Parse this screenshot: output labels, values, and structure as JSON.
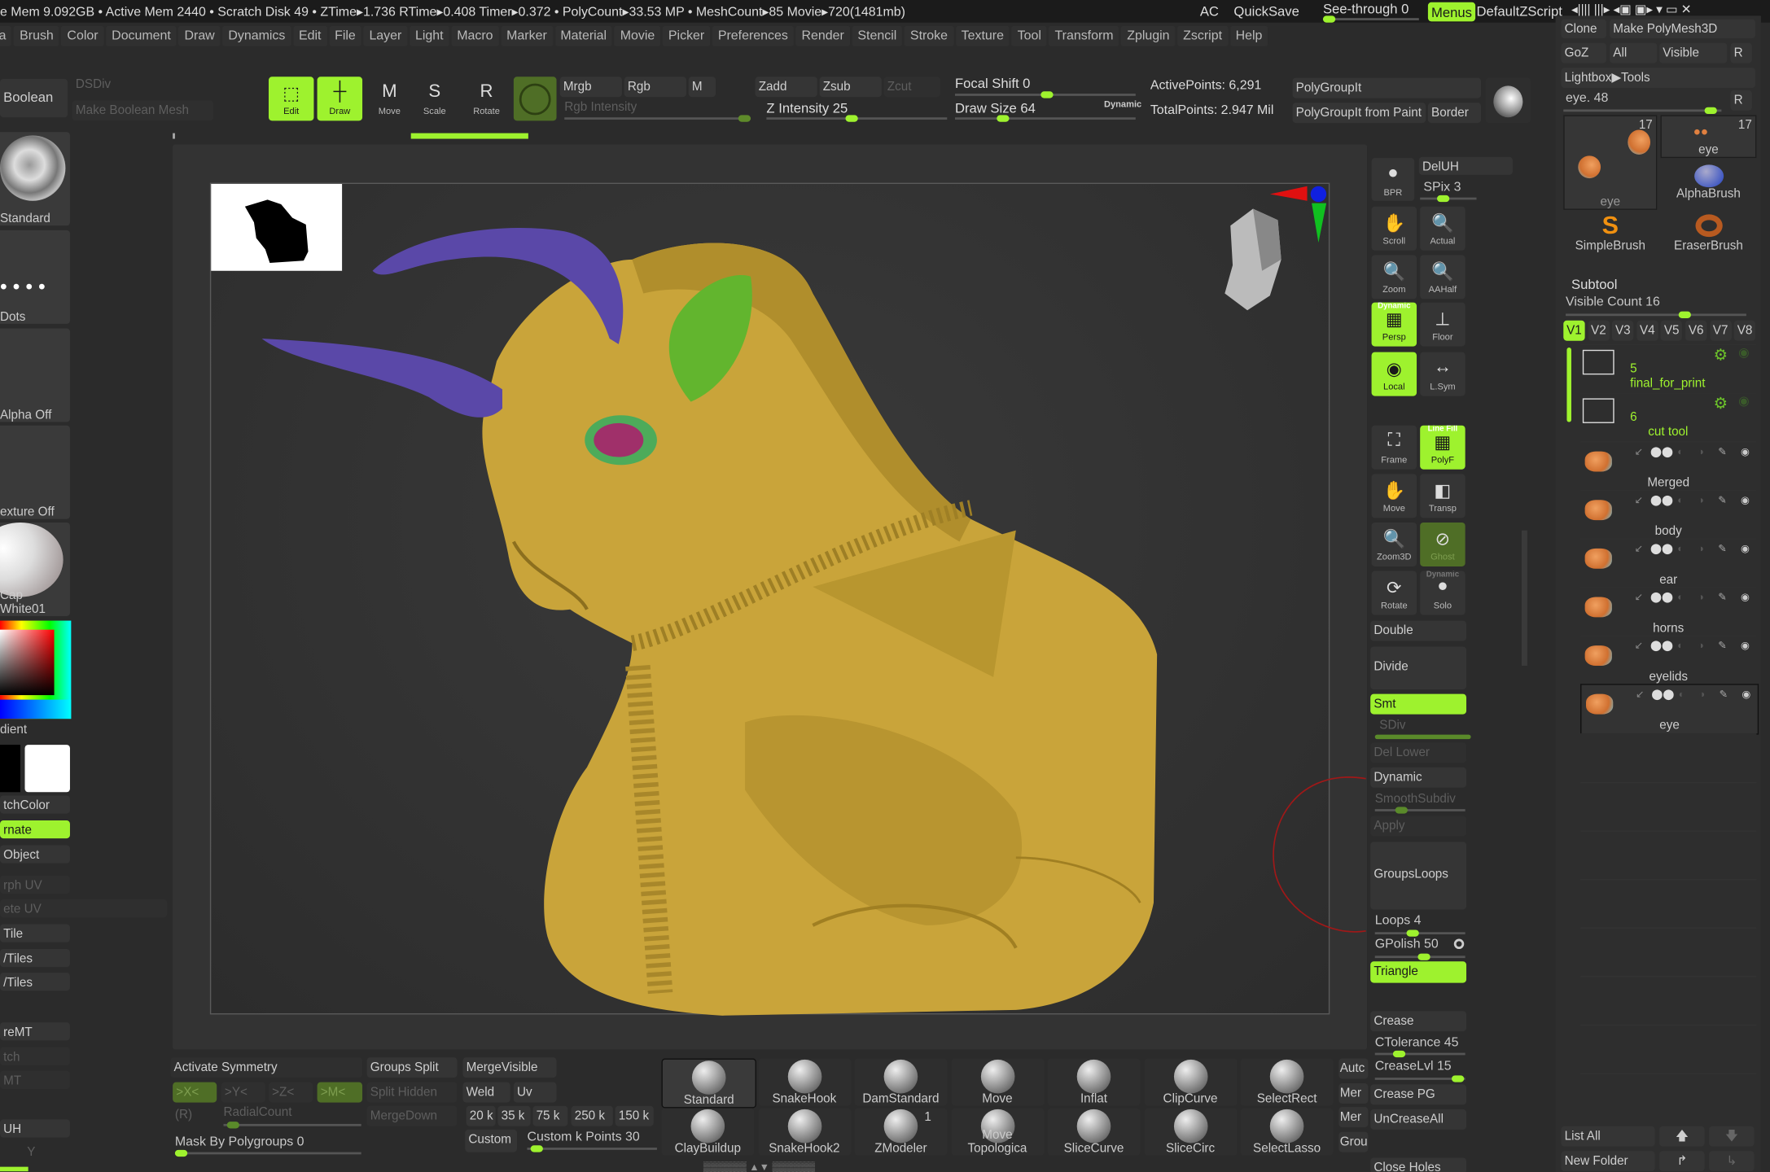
{
  "status_bar": {
    "text": "e Mem 9.092GB • Active Mem 2440 • Scratch Disk 49 •  ZTime▸1.736 RTime▸0.408 Timer▸0.372 • PolyCount▸33.53 MP  • MeshCount▸85  Movie▸720(1481mb)",
    "ac": "AC",
    "quicksave": "QuickSave",
    "see_through": "See-through  0",
    "see_through_value": 0,
    "menus": "Menus",
    "default_zscript": "DefaultZScript"
  },
  "menu": [
    "a",
    "Brush",
    "Color",
    "Document",
    "Draw",
    "Dynamics",
    "Edit",
    "File",
    "Layer",
    "Light",
    "Macro",
    "Marker",
    "Material",
    "Movie",
    "Picker",
    "Preferences",
    "Render",
    "Stencil",
    "Stroke",
    "Texture",
    "Tool",
    "Transform",
    "Zplugin",
    "Zscript",
    "Help"
  ],
  "toolbar": {
    "boolean": "Boolean",
    "dsdiv": "DSDiv",
    "make_boolean_mesh": "Make Boolean Mesh",
    "edit": "Edit",
    "draw": "Draw",
    "move": "Move",
    "scale": "Scale",
    "rotate": "Rotate",
    "mrgb": "Mrgb",
    "rgb": "Rgb",
    "m": "M",
    "rgb_intensity": "Rgb Intensity",
    "zadd": "Zadd",
    "zsub": "Zsub",
    "zcut": "Zcut",
    "z_intensity": "Z Intensity 25",
    "z_intensity_value": 25,
    "focal_shift": "Focal Shift 0",
    "focal_shift_value": 0,
    "draw_size": "Draw Size 64",
    "draw_size_value": 64,
    "dynamic": "Dynamic",
    "active_points": "ActivePoints: 6,291",
    "total_points": "TotalPoints: 2.947 Mil",
    "polygroupit": "PolyGroupIt",
    "polygroupit_from_paint": "PolyGroupIt from Paint",
    "border": "Border"
  },
  "left_shelf": {
    "brush": "Standard",
    "stroke": "Dots",
    "alpha": "Alpha Off",
    "texture": "exture Off",
    "material": "Cap White01",
    "gradient": "dient",
    "switch_color": "tchColor",
    "alternate": "rnate",
    "object": "Object",
    "morph_uv": "rph UV",
    "delete_uv": "ete UV",
    "tile": "Tile",
    "utiles": "/Tiles",
    "vtiles": "/Tiles",
    "remt": "reMT",
    "tch": "tch",
    "mt": "MT",
    "uh": "UH",
    "y": "Y"
  },
  "right_tools": {
    "bpr": "BPR",
    "deluh": "DelUH",
    "spix": "SPix 3",
    "scroll": "Scroll",
    "actual": "Actual",
    "zoom": "Zoom",
    "aahalf": "AAHalf",
    "persp": "Persp",
    "persp_tag": "Dynamic",
    "floor": "Floor",
    "local": "Local",
    "lsym": "L.Sym",
    "frame": "Frame",
    "polyf": "PolyF",
    "polyf_tag": "Line Fill",
    "move": "Move",
    "transp": "Transp",
    "zoom3d": "Zoom3D",
    "ghost": "Ghost",
    "rotate": "Rotate",
    "solo": "Solo",
    "solo_tag": "Dynamic",
    "double": "Double",
    "divide": "Divide",
    "smt": "Smt",
    "sdiv": "SDiv",
    "del_lower": "Del Lower",
    "dynamic": "Dynamic",
    "smooth_subdiv": "SmoothSubdiv",
    "apply": "Apply",
    "groups_loops": "GroupsLoops",
    "loops": "Loops 4",
    "gpolish": "GPolish 50",
    "triangle": "Triangle",
    "crease": "Crease",
    "ctolerance": "CTolerance 45",
    "creaselvl": "CreaseLvl 15",
    "crease_pg": "Crease PG",
    "uncrease_all": "UnCreaseAll",
    "close_holes": "Close Holes"
  },
  "tool_panel": {
    "clone": "Clone",
    "make_polymesh": "Make PolyMesh3D",
    "goz": "GoZ",
    "all": "All",
    "visible": "Visible",
    "r": "R",
    "lightbox_tools": "Lightbox▶Tools",
    "current_tool": "eye. 48",
    "thumbs": [
      {
        "label": "eye",
        "count": "17"
      },
      {
        "label": "eye",
        "count": "17"
      },
      {
        "label": "AlphaBrush"
      },
      {
        "label": "SimpleBrush"
      },
      {
        "label": "EraserBrush"
      }
    ]
  },
  "subtool": {
    "title": "Subtool",
    "visible_count": "Visible Count 16",
    "versions": [
      "V1",
      "V2",
      "V3",
      "V4",
      "V5",
      "V6",
      "V7",
      "V8"
    ],
    "active_version": "V1",
    "items": [
      {
        "number": "5",
        "name": "final_for_print",
        "type": "folder"
      },
      {
        "number": "6",
        "name": "cut tool",
        "type": "folder"
      },
      {
        "name": "Merged"
      },
      {
        "name": "body"
      },
      {
        "name": "ear"
      },
      {
        "name": "horns"
      },
      {
        "name": "eyelids"
      },
      {
        "name": "eye",
        "selected": true
      }
    ],
    "list_all": "List All",
    "new_folder": "New Folder"
  },
  "bottom": {
    "activate_symmetry": "Activate Symmetry",
    "x": ">X<",
    "y": ">Y<",
    "z": ">Z<",
    "m": ">M<",
    "r": "(R)",
    "radial_count": "RadialCount",
    "mask_by_polygroups": "Mask By Polygroups 0",
    "groups_split": "Groups Split",
    "split_hidden": "Split Hidden",
    "merge_down": "MergeDown",
    "merge_visible": "MergeVisible",
    "weld": "Weld",
    "uv": "Uv",
    "presets": [
      "20 k",
      "35 k",
      "75 k",
      "250 k",
      "150 k"
    ],
    "custom": "Custom",
    "custom_k_points": "Custom k Points 30",
    "brushes": [
      "Standard",
      "SnakeHook",
      "DamStandard",
      "Move",
      "Inflat",
      "ClipCurve",
      "SelectRect",
      "ClayBuildup",
      "SnakeHook2",
      "ZModeler",
      "Move Topologica",
      "SliceCurve",
      "SliceCirc",
      "SelectLasso"
    ],
    "zmodeler_badge": "1",
    "side": [
      "Autc",
      "Mer",
      "Mer",
      "Grou"
    ]
  },
  "colors": {
    "accent": "#9ef22e",
    "model": "#c9a43a",
    "horns": "#5a48a8",
    "ear": "#62b52e",
    "background": "#2b2b2b"
  }
}
